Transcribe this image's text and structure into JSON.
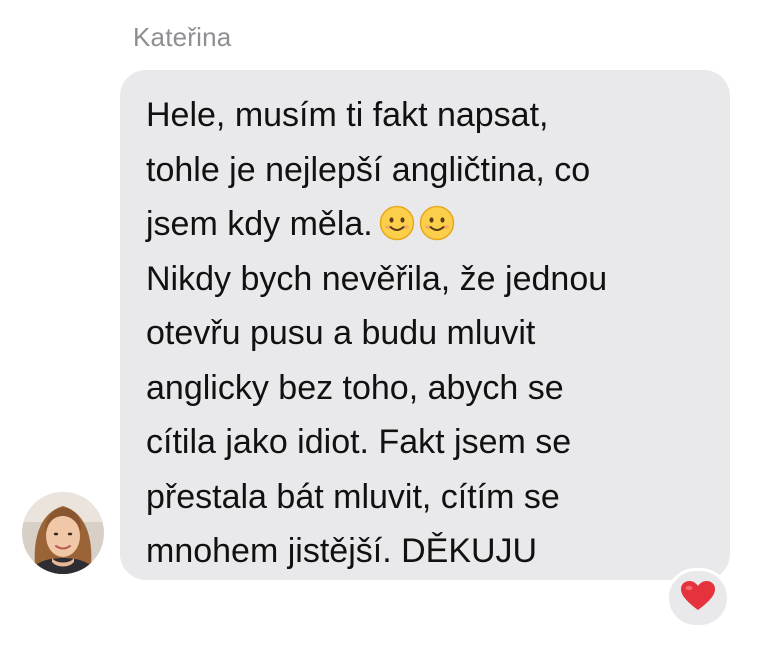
{
  "sender": {
    "name": "Kateřina"
  },
  "message": {
    "lines": [
      "Hele, musím ti fakt napsat,",
      "tohle je nejlepší angličtina, co",
      "jsem kdy měla.",
      "Nikdy bych nevěřila, že jednou",
      "otevřu pusu a budu mluvit",
      "anglicky bez toho, abych se",
      "cítila jako idiot. Fakt jsem se",
      "přestala bát mluvit, cítím se",
      "mnohem jistější. DĚKUJU"
    ],
    "inline_emoji": [
      "smiling-face-icon",
      "smiling-face-icon"
    ]
  },
  "reaction": {
    "icon": "red-heart-icon",
    "color": "#e5323c"
  },
  "colors": {
    "bubble": "#e9e9eb",
    "sender_name": "#8e8e93",
    "text": "#111111"
  }
}
